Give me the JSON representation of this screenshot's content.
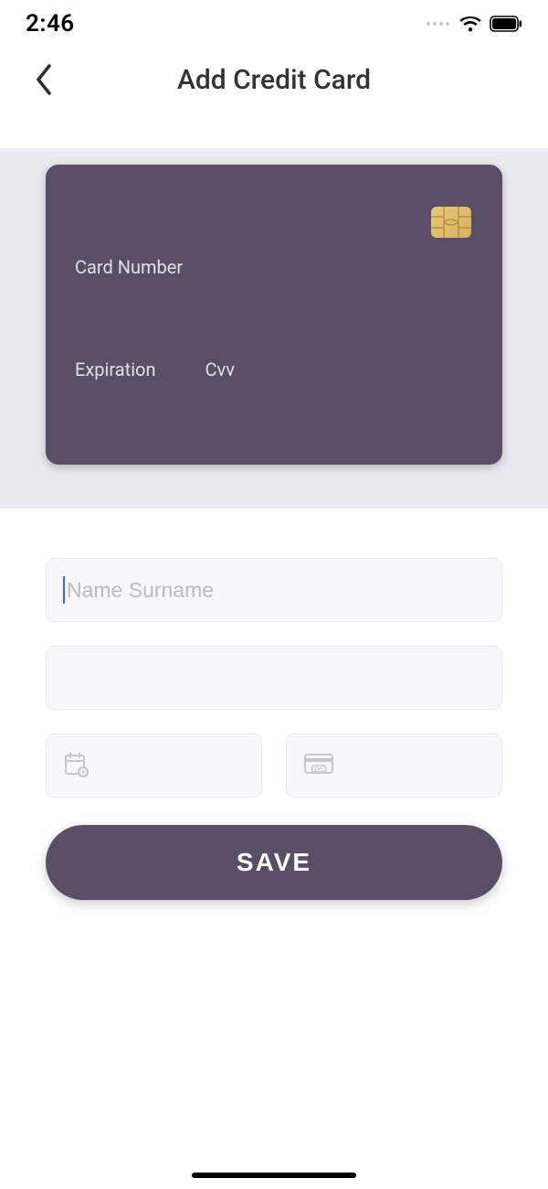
{
  "status": {
    "time": "2:46"
  },
  "header": {
    "title": "Add Credit Card"
  },
  "card": {
    "number_label": "Card Number",
    "expiration_label": "Expiration",
    "cvv_label": "Cvv"
  },
  "form": {
    "name_placeholder": "Name Surname",
    "name_value": "",
    "card_number_value": "",
    "expiry_value": "",
    "cvv_value": ""
  },
  "actions": {
    "save_label": "SAVE"
  },
  "colors": {
    "accent": "#5a4d66",
    "area_bg": "#e9ebf1",
    "field_bg": "#f8f7fb"
  }
}
